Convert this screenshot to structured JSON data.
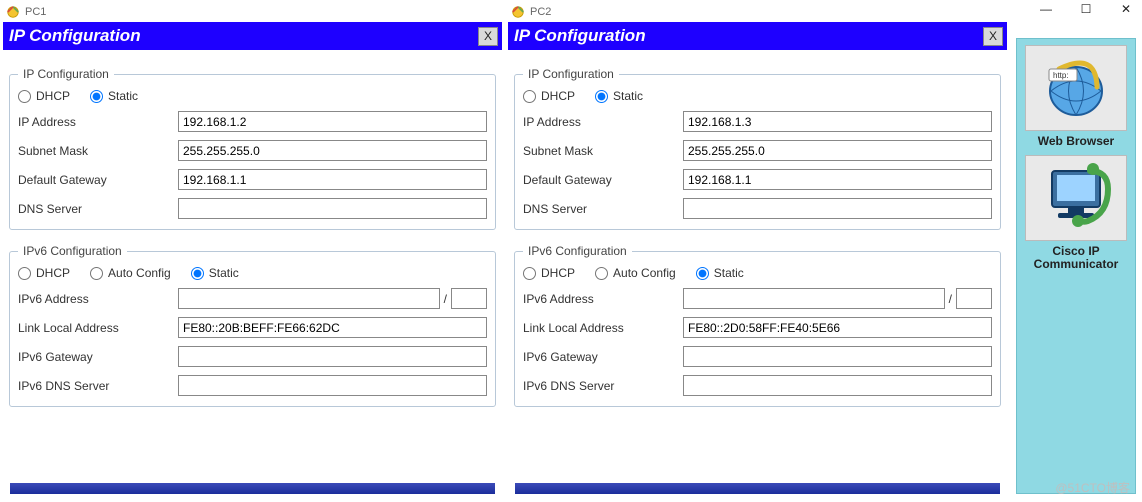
{
  "panels": [
    {
      "title": "PC1",
      "header": "IP Configuration",
      "close_label": "X",
      "ipv4": {
        "legend": "IP Configuration",
        "dhcp_label": "DHCP",
        "static_label": "Static",
        "selected": "static",
        "fields": {
          "ip_label": "IP Address",
          "ip_value": "192.168.1.2",
          "mask_label": "Subnet Mask",
          "mask_value": "255.255.255.0",
          "gw_label": "Default Gateway",
          "gw_value": "192.168.1.1",
          "dns_label": "DNS Server",
          "dns_value": ""
        }
      },
      "ipv6": {
        "legend": "IPv6 Configuration",
        "dhcp_label": "DHCP",
        "auto_label": "Auto Config",
        "static_label": "Static",
        "selected": "static",
        "fields": {
          "addr_label": "IPv6 Address",
          "addr_value": "",
          "prefix_value": "",
          "lla_label": "Link Local Address",
          "lla_value": "FE80::20B:BEFF:FE66:62DC",
          "gw_label": "IPv6 Gateway",
          "gw_value": "",
          "dns_label": "IPv6 DNS Server",
          "dns_value": ""
        }
      }
    },
    {
      "title": "PC2",
      "header": "IP Configuration",
      "close_label": "X",
      "ipv4": {
        "legend": "IP Configuration",
        "dhcp_label": "DHCP",
        "static_label": "Static",
        "selected": "static",
        "fields": {
          "ip_label": "IP Address",
          "ip_value": "192.168.1.3",
          "mask_label": "Subnet Mask",
          "mask_value": "255.255.255.0",
          "gw_label": "Default Gateway",
          "gw_value": "192.168.1.1",
          "dns_label": "DNS Server",
          "dns_value": ""
        }
      },
      "ipv6": {
        "legend": "IPv6 Configuration",
        "dhcp_label": "DHCP",
        "auto_label": "Auto Config",
        "static_label": "Static",
        "selected": "static",
        "fields": {
          "addr_label": "IPv6 Address",
          "addr_value": "",
          "prefix_value": "",
          "lla_label": "Link Local Address",
          "lla_value": "FE80::2D0:58FF:FE40:5E66",
          "gw_label": "IPv6 Gateway",
          "gw_value": "",
          "dns_label": "IPv6 DNS Server",
          "dns_value": ""
        }
      }
    }
  ],
  "sidebar": {
    "items": [
      {
        "label": "Web Browser",
        "icon": "browser"
      },
      {
        "label": "Cisco IP Communicator",
        "icon": "ip-phone"
      }
    ]
  },
  "win": {
    "min": "—",
    "max": "☐",
    "close": "✕"
  },
  "watermark": "@51CTO博客",
  "slash": "/"
}
